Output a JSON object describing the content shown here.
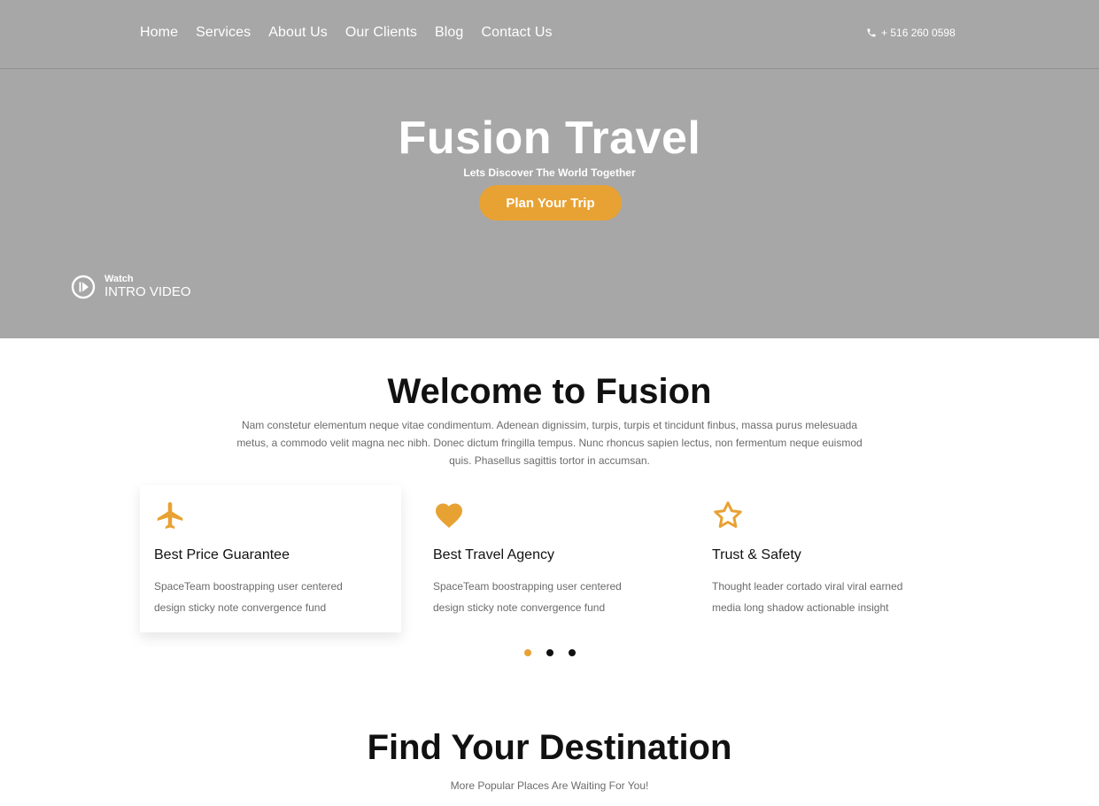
{
  "nav": {
    "items": [
      "Home",
      "Services",
      "About Us",
      "Our Clients",
      "Blog",
      "Contact Us"
    ],
    "phone": "+ 516 260 0598"
  },
  "hero": {
    "title": "Fusion Travel",
    "subtitle": "Lets Discover The World Together",
    "cta": "Plan Your Trip",
    "watch_small": "Watch",
    "watch_big": "INTRO VIDEO"
  },
  "welcome": {
    "title": "Welcome to Fusion",
    "text": "Nam constetur elementum neque vitae condimentum. Adenean dignissim, turpis, turpis et tincidunt finbus, massa purus melesuada metus, a commodo velit magna nec nibh. Donec dictum fringilla tempus. Nunc rhoncus sapien lectus, non fermentum neque euismod quis. Phasellus sagittis tortor in accumsan."
  },
  "features": [
    {
      "icon": "plane-icon",
      "title": "Best Price Guarantee",
      "text": "SpaceTeam boostrapping user centered design sticky note convergence fund"
    },
    {
      "icon": "heart-icon",
      "title": "Best Travel Agency",
      "text": "SpaceTeam boostrapping user centered design sticky note convergence fund"
    },
    {
      "icon": "star-icon",
      "title": "Trust & Safety",
      "text": "Thought leader cortado viral viral earned media long shadow actionable insight"
    }
  ],
  "carousel": {
    "active_index": 0,
    "count": 3
  },
  "destination": {
    "title": "Find Your Destination",
    "subtitle": "More Popular Places Are Waiting For You!"
  },
  "colors": {
    "accent": "#e8a233",
    "hero_bg": "#a7a7a7"
  }
}
